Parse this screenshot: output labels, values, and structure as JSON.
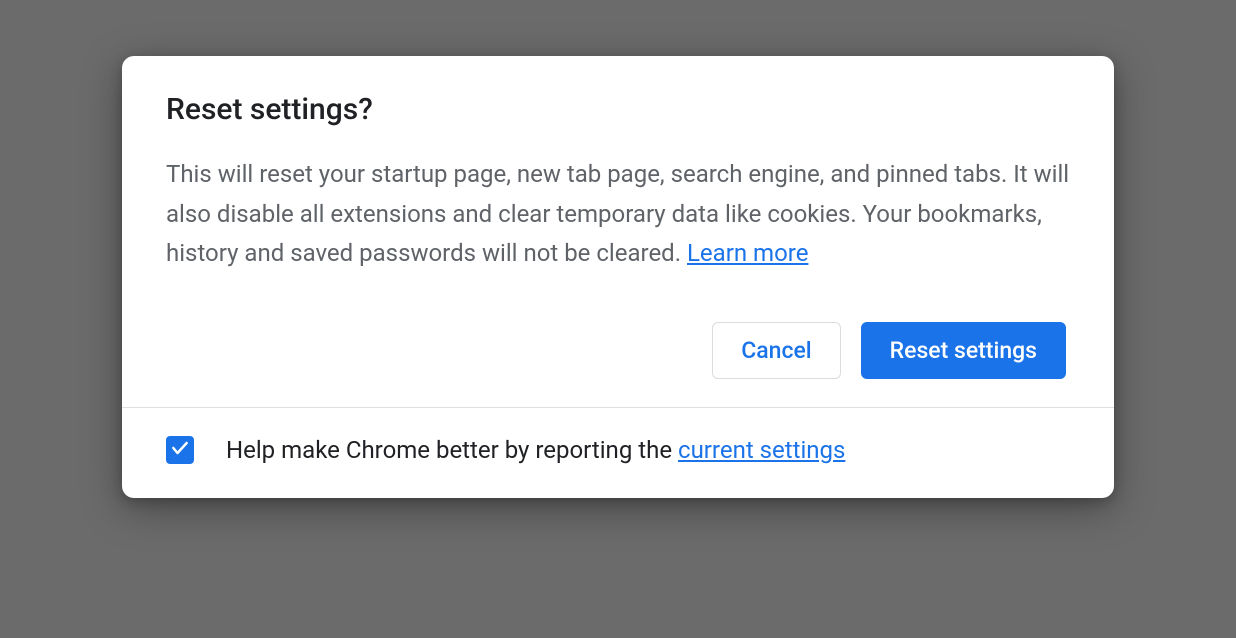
{
  "dialog": {
    "title": "Reset settings?",
    "description": "This will reset your startup page, new tab page, search engine, and pinned tabs. It will also disable all extensions and clear temporary data like cookies. Your bookmarks, history and saved passwords will not be cleared.",
    "learn_more_label": " Learn more",
    "buttons": {
      "cancel": "Cancel",
      "confirm": "Reset settings"
    }
  },
  "footer": {
    "checkbox_checked": true,
    "text_prefix": "Help make Chrome better by reporting the ",
    "link_text": "current settings"
  }
}
